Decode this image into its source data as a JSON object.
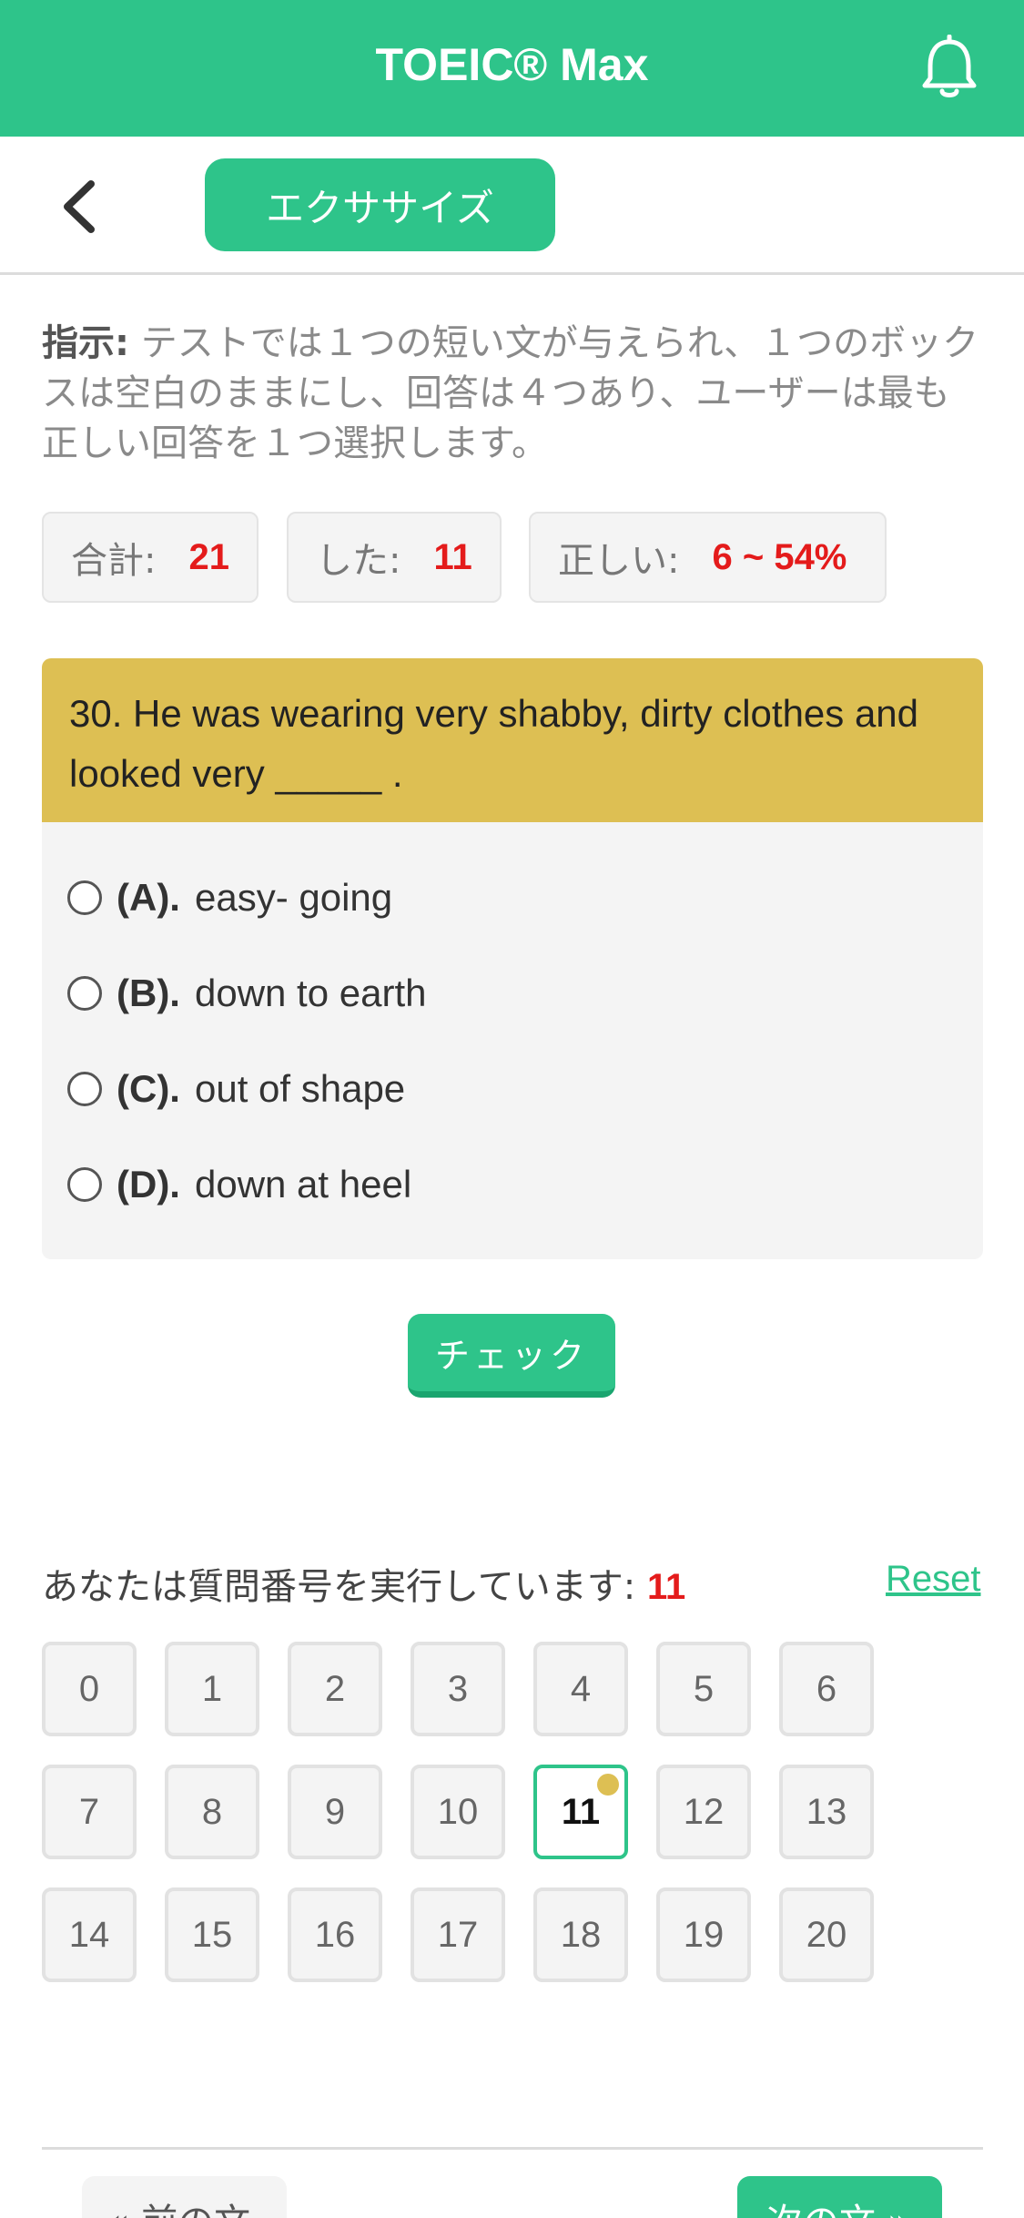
{
  "header": {
    "title": "TOEIC® Max",
    "bell_icon": "bell-icon"
  },
  "subnav": {
    "back_icon": "chevron-left-icon",
    "tab_label": "エクササイズ"
  },
  "instructions": {
    "label": "指示:",
    "text": " テストでは１つの短い文が与えられ、１つのボックスは空白のままにし、回答は４つあり、ユーザーは最も正しい回答を１つ選択します。"
  },
  "stats": [
    {
      "label": "合計:",
      "value": "21"
    },
    {
      "label": "した:",
      "value": "11"
    },
    {
      "label": "正しい:",
      "value": "6 ~ 54%"
    }
  ],
  "question": {
    "text": "30. He was wearing very shabby, dirty clothes and looked very _____ .",
    "options": [
      {
        "letter": "(A).",
        "text": "easy- going"
      },
      {
        "letter": "(B).",
        "text": "down to earth"
      },
      {
        "letter": "(C).",
        "text": "out of shape"
      },
      {
        "letter": "(D).",
        "text": "down at heel"
      }
    ]
  },
  "check_button": "チェック",
  "progress": {
    "label": "あなたは質問番号を実行しています:",
    "current": "11",
    "reset_label": "Reset"
  },
  "question_numbers": [
    "0",
    "1",
    "2",
    "3",
    "4",
    "5",
    "6",
    "7",
    "8",
    "9",
    "10",
    "11",
    "12",
    "13",
    "14",
    "15",
    "16",
    "17",
    "18",
    "19",
    "20"
  ],
  "active_question": "11",
  "footer": {
    "prev_label": "« 前の文",
    "next_label": "次の文 »"
  },
  "colors": {
    "accent": "#2ec48a",
    "question_header": "#ddbf53",
    "highlight_value": "#e41b1b"
  }
}
